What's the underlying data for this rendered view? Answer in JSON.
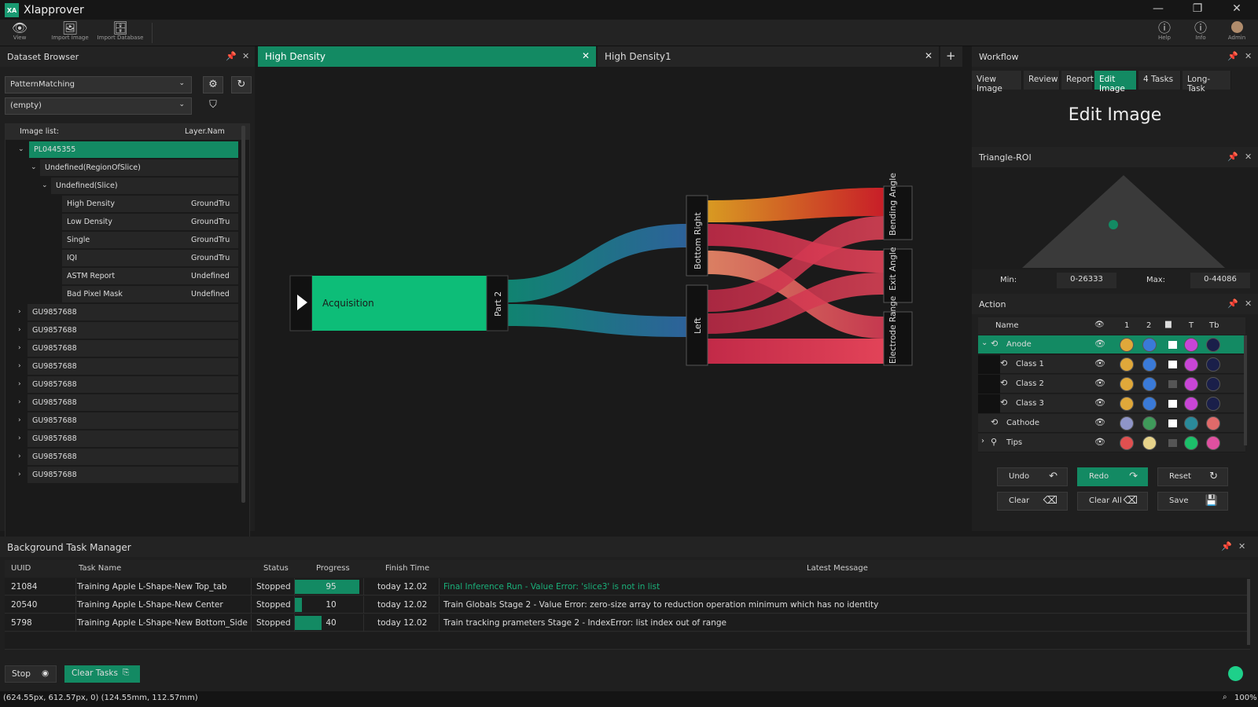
{
  "app": {
    "title": "XIapprover",
    "logo_text": "XA"
  },
  "toolbar": {
    "view": "View",
    "import_image": "Import Image",
    "import_database": "Import Database",
    "help": "Help",
    "info": "Info",
    "admin": "Admin"
  },
  "dataset": {
    "title": "Dataset Browser",
    "select1": "PatternMatching",
    "select2": "(empty)",
    "col1": "Image list:",
    "col2": "Layer.Nam",
    "root": "PL0445355",
    "child1": "Undefined(RegionOfSlice)",
    "child2": "Undefined(Slice)",
    "leaves": [
      {
        "name": "High Density",
        "layer": "GroundTru"
      },
      {
        "name": "Low Density",
        "layer": "GroundTru"
      },
      {
        "name": "Single",
        "layer": "GroundTru"
      },
      {
        "name": "IQI",
        "layer": "GroundTru"
      },
      {
        "name": "ASTM Report",
        "layer": "Undefined"
      },
      {
        "name": "Bad Pixel Mask",
        "layer": "Undefined"
      }
    ],
    "groups": [
      "GU9857688",
      "GU9857688",
      "GU9857688",
      "GU9857688",
      "GU9857688",
      "GU9857688",
      "GU9857688",
      "GU9857688",
      "GU9857688",
      "GU9857688"
    ]
  },
  "center": {
    "tab1": "High Density",
    "tab2": "High Density1",
    "add": "+",
    "nodes": {
      "acquisition": "Acquisition",
      "part2": "Part 2",
      "bottom_right": "Bottom Right",
      "left": "Left",
      "bending_angle": "Bending Angle",
      "exit_angle": "Exit Angle",
      "electrode_range": "Electrode Range"
    }
  },
  "workflow": {
    "title": "Workflow",
    "tabs": [
      "View Image",
      "Review",
      "Report",
      "Edit Image",
      "4 Tasks",
      "Long-Task"
    ],
    "active_tab": "Edit Image",
    "heading": "Edit Image"
  },
  "roi": {
    "title": "Triangle-ROI",
    "min_label": "Min:",
    "min_value": "0-26333",
    "max_label": "Max:",
    "max_value": "0-44086"
  },
  "action": {
    "title": "Action",
    "col_name": "Name",
    "col_1": "1",
    "col_2": "2",
    "col_t": "T",
    "col_tb": "Tb",
    "rows": [
      {
        "name": "Anode",
        "colors": [
          "#e0a83a",
          "#3a7ad8",
          "#ffffff",
          "#c845d6",
          "#1a1f4a"
        ]
      },
      {
        "name": "Class 1",
        "colors": [
          "#e0a83a",
          "#3a7ad8",
          "#ffffff",
          "#c845d6",
          "#1a1f4a"
        ]
      },
      {
        "name": "Class 2",
        "colors": [
          "#e0a83a",
          "#3a7ad8",
          "#555555",
          "#c845d6",
          "#1a1f4a"
        ]
      },
      {
        "name": "Class 3",
        "colors": [
          "#e0a83a",
          "#3a7ad8",
          "#ffffff",
          "#c845d6",
          "#1a1f4a"
        ]
      },
      {
        "name": "Cathode",
        "colors": [
          "#8f95c8",
          "#3f9a5a",
          "#ffffff",
          "#2a8a9a",
          "#e06a6a"
        ]
      },
      {
        "name": "Tips",
        "colors": [
          "#e05050",
          "#e6d28a",
          "#555555",
          "#1cc06a",
          "#e050a0"
        ]
      }
    ],
    "buttons": {
      "undo": "Undo",
      "redo": "Redo",
      "reset": "Reset",
      "clear": "Clear",
      "clear_all": "Clear All",
      "save": "Save"
    }
  },
  "tasks": {
    "title": "Background Task Manager",
    "headers": {
      "uuid": "UUID",
      "name": "Task Name",
      "status": "Status",
      "progress": "Progress",
      "finish": "Finish Time",
      "message": "Latest Message"
    },
    "rows": [
      {
        "uuid": "21084",
        "name": "Training Apple L-Shape-New Top_tab",
        "status": "Stopped",
        "progress": 95,
        "finish": "today 12.02",
        "message": "Final Inference Run - Value Error: 'slice3' is not in list"
      },
      {
        "uuid": "20540",
        "name": "Training Apple L-Shape-New Center",
        "status": "Stopped",
        "progress": 10,
        "finish": "today 12.02",
        "message": "Train Globals Stage 2 - Value Error: zero-size array to reduction operation minimum which has no identity"
      },
      {
        "uuid": "5798",
        "name": "Training Apple L-Shape-New Bottom_Side",
        "status": "Stopped",
        "progress": 40,
        "finish": "today 12.02",
        "message": "Train tracking prameters Stage 2 -  IndexError: list index out of range"
      }
    ],
    "stop": "Stop",
    "clear_tasks": "Clear Tasks"
  },
  "status": {
    "coords": "(624.55px, 612.57px, 0) (124.55mm, 112.57mm)",
    "zoom": "100%"
  },
  "colors": {
    "accent": "#138a63",
    "node_green": "#0dbd78"
  }
}
